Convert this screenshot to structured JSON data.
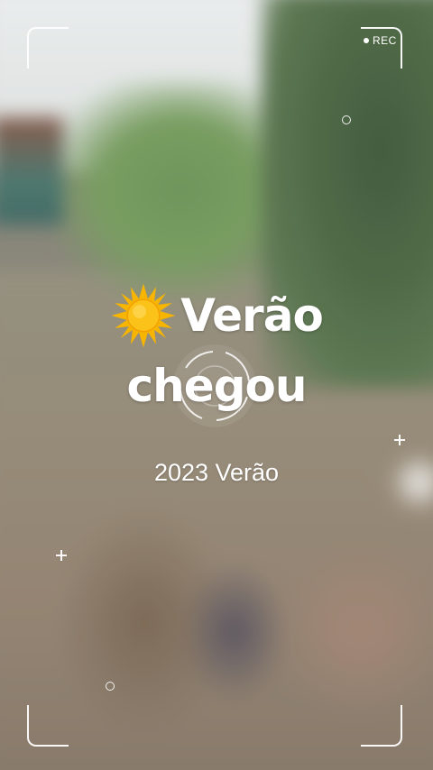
{
  "camera": {
    "rec_label": "REC",
    "icons": [
      "rec-dot-icon",
      "focus-reticle-icon",
      "crosshair-plus-icon",
      "small-circle-icon"
    ]
  },
  "overlay": {
    "emoji_icon": "sun-icon",
    "title_line1": "Verão",
    "title_line2": "chegou",
    "subtitle": "2023 Verão"
  },
  "colors": {
    "text": "#ffffff",
    "sun": "#f7b500"
  }
}
